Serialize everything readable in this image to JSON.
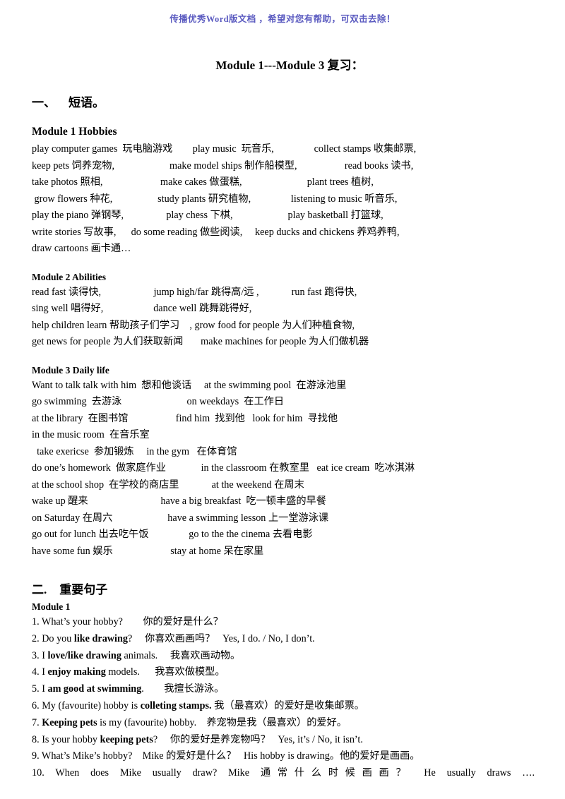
{
  "watermark": {
    "text": "传播优秀Word版文档 ，希望对您有帮助，可双击去除！",
    "color": "#5b5bc0"
  },
  "document": {
    "title": "Module 1---Module 3  复习："
  },
  "sections": [
    {
      "number": "一、",
      "label": "短语。"
    },
    {
      "number": "二.",
      "label": "重要句子"
    }
  ],
  "modules": {
    "m1": {
      "heading": "Module 1 Hobbies",
      "lines": [
        "play computer games  玩电脑游戏        play music  玩音乐,                collect stamps 收集邮票,",
        "keep pets 饲养宠物,                      make model ships 制作船模型,                   read books 读书,",
        "take photos 照相,                       make cakes 做蛋糕,                          plant trees 植树,",
        " grow flowers 种花,                  study plants 研究植物,                listening to music 听音乐,",
        "play the piano 弹钢琴,                 play chess 下棋,                      play basketball 打篮球,",
        "write stories 写故事,      do some reading 做些阅读,     keep ducks and chickens 养鸡养鸭,",
        "draw cartoons 画卡通…"
      ]
    },
    "m2": {
      "heading": "Module 2 Abilities",
      "lines": [
        "read fast 读得快,                     jump high/far 跳得高/远 ,             run fast 跑得快,",
        "sing well 唱得好,                    dance well 跳舞跳得好,",
        "help children learn 帮助孩子们学习    , grow food for people 为人们种植食物,",
        "get news for people 为人们获取新闻       make machines for people 为人们做机器"
      ]
    },
    "m3": {
      "heading": "Module 3 Daily life",
      "lines": [
        "Want to talk talk with him  想和他谈话     at the swimming pool  在游泳池里",
        "go swimming  去游泳                          on weekdays  在工作日",
        "at the library  在图书馆                   find him  找到他   look for him  寻找他",
        "in the music room  在音乐室",
        "  take exericse  参加锻炼     in the gym   在体育馆",
        "do one’s homework  做家庭作业              in the classroom 在教室里   eat ice cream  吃冰淇淋",
        "at the school shop  在学校的商店里             at the weekend 在周末",
        "wake up 醒来                             have a big breakfast  吃一顿丰盛的早餐",
        "on Saturday 在周六                      have a swimming lesson 上一堂游泳课",
        "go out for lunch 出去吃午饭                go to the the cinema 去看电影",
        "have some fun 娱乐                       stay at home 呆在家里"
      ]
    },
    "m1_sentences": {
      "heading": "Module 1",
      "items": [
        {
          "html": "1. What’s your hobby?        你的爱好是什么？"
        },
        {
          "html": "2. Do you <b>like drawing</b>?     你喜欢画画吗？   Yes, I do. / No, I don’t."
        },
        {
          "html": "3. I <b>love/like drawing</b> animals.     我喜欢画动物。"
        },
        {
          "html": "4. I <b>enjoy making</b> models.      我喜欢做模型。"
        },
        {
          "html": "5. I <b>am good at swimming</b>.        我擅长游泳。"
        },
        {
          "html": "6. My (favourite) hobby is <b>colleting stamps.</b> 我（最喜欢）的爱好是收集邮票。"
        },
        {
          "html": "7. <b>Keeping pets</b> is my (favourite) hobby.    养宠物是我（最喜欢）的爱好。"
        },
        {
          "html": "8. Is your hobby <b>keeping pets</b>?     你的爱好是养宠物吗？   Yes, it’s / No, it isn’t."
        },
        {
          "html": "9. What’s Mike’s hobby?    Mike 的爱好是什么？   His hobby is drawing。他的爱好是画画。"
        },
        {
          "html": "10. When does Mike usually draw? Mike 通常什么时候画画？ He usually draws ….",
          "justified": true
        }
      ]
    }
  }
}
